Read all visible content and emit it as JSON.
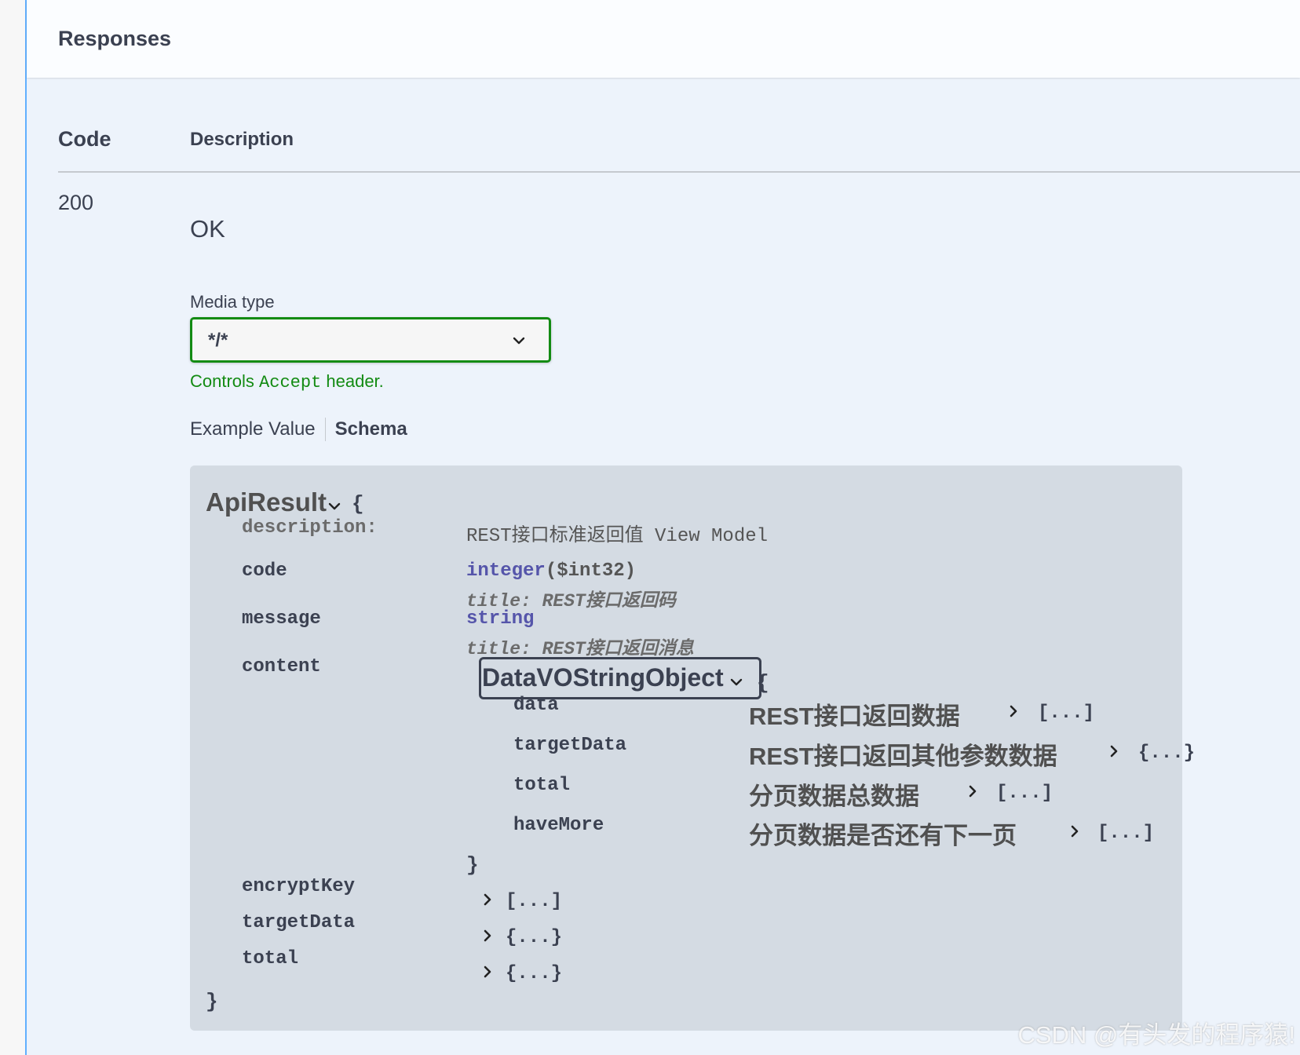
{
  "responses": {
    "title": "Responses",
    "columns": {
      "code": "Code",
      "description": "Description"
    },
    "row": {
      "code": "200",
      "description": "OK",
      "media_type": {
        "label": "Media type",
        "value": "*/*",
        "hint_prefix": "Controls ",
        "hint_code": "Accept",
        "hint_suffix": " header."
      },
      "tabs": {
        "example_value": "Example Value",
        "schema": "Schema"
      }
    }
  },
  "schema": {
    "model_name": "ApiResult",
    "open_brace": "{",
    "close_brace": "}",
    "description_key": "description:",
    "description_value": "REST接口标准返回值 View Model",
    "properties": {
      "code": {
        "name": "code",
        "type": "integer",
        "format": "($int32)",
        "title": "title: REST接口返回码"
      },
      "message": {
        "name": "message",
        "type": "string",
        "title": "title: REST接口返回消息"
      },
      "content": {
        "name": "content",
        "model_name": "DataVOStringObject",
        "open_brace": "{",
        "close_brace": "}",
        "fields": [
          {
            "name": "data",
            "description": "REST接口返回数据",
            "collapsed": "[...]"
          },
          {
            "name": "targetData",
            "description": "REST接口返回其他参数数据",
            "collapsed": "{...}"
          },
          {
            "name": "total",
            "description": "分页数据总数据",
            "collapsed": "[...]"
          },
          {
            "name": "haveMore",
            "description": "分页数据是否还有下一页",
            "collapsed": "[...]"
          }
        ]
      },
      "encryptKey": {
        "name": "encryptKey",
        "collapsed": "[...]"
      },
      "targetData": {
        "name": "targetData",
        "collapsed": "{...}"
      },
      "total": {
        "name": "total",
        "collapsed": "{...}"
      }
    }
  },
  "watermark": "CSDN @有头发的程序猿!",
  "colors": {
    "accent_border": "#61affe",
    "select_border": "#138b13",
    "hint_text": "#138b13",
    "schema_box": "#d4dbe3",
    "primitive_type": "#55aa"
  },
  "icons": {
    "select_chevron": "chevron-down-icon",
    "model_toggle": "chevron-down-icon",
    "expand": "chevron-right-icon"
  }
}
